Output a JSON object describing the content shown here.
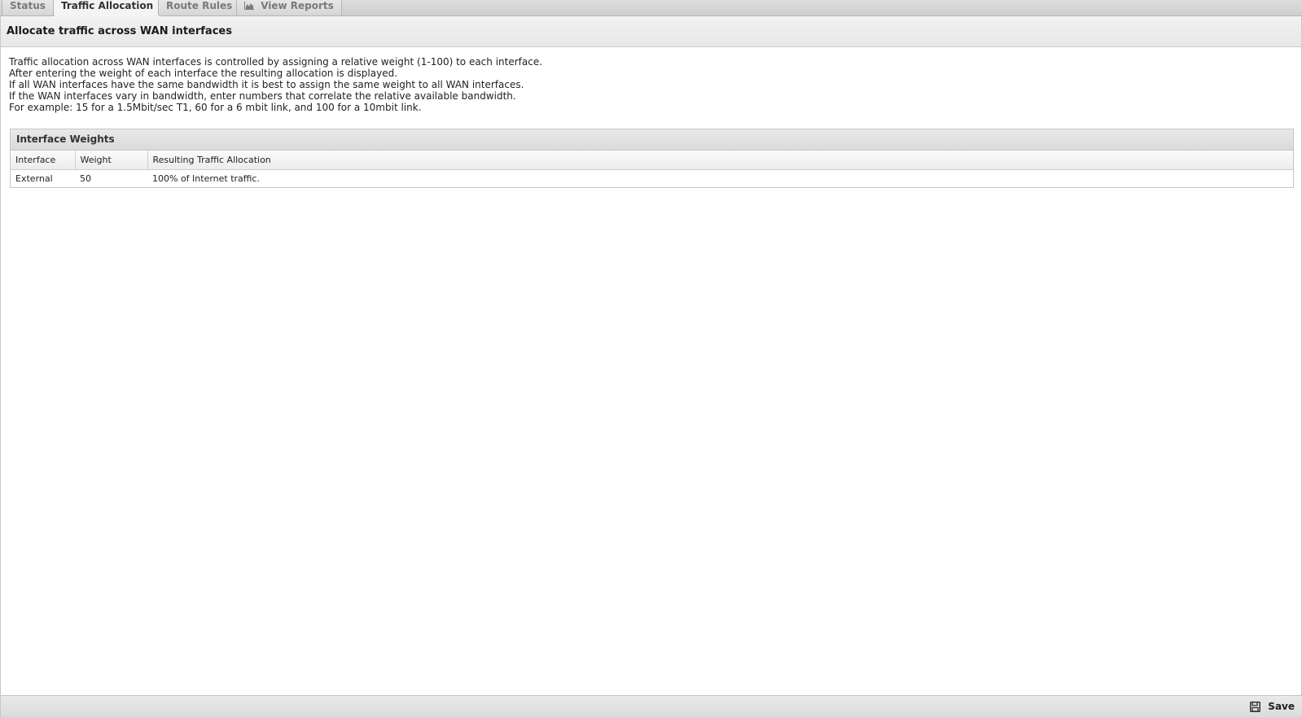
{
  "tabs": [
    {
      "label": "Status",
      "active": false
    },
    {
      "label": "Traffic Allocation",
      "active": true
    },
    {
      "label": "Route Rules",
      "active": false
    },
    {
      "label": "View Reports",
      "active": false,
      "icon": "chart-icon"
    }
  ],
  "page": {
    "title": "Allocate traffic across WAN interfaces",
    "description": [
      "Traffic allocation across WAN interfaces is controlled by assigning a relative weight (1-100) to each interface.",
      "After entering the weight of each interface the resulting allocation is displayed.",
      "If all WAN interfaces have the same bandwidth it is best to assign the same weight to all WAN interfaces.",
      "If the WAN interfaces vary in bandwidth, enter numbers that correlate the relative available bandwidth.",
      "For example: 15 for a 1.5Mbit/sec T1, 60 for a 6 mbit link, and 100 for a 10mbit link."
    ]
  },
  "weights": {
    "title": "Interface Weights",
    "columns": [
      "Interface",
      "Weight",
      "Resulting Traffic Allocation"
    ],
    "rows": [
      {
        "interface": "External",
        "weight": "50",
        "allocation": "100% of Internet traffic."
      }
    ]
  },
  "footer": {
    "save_label": "Save",
    "save_icon": "floppy-disk-icon"
  }
}
